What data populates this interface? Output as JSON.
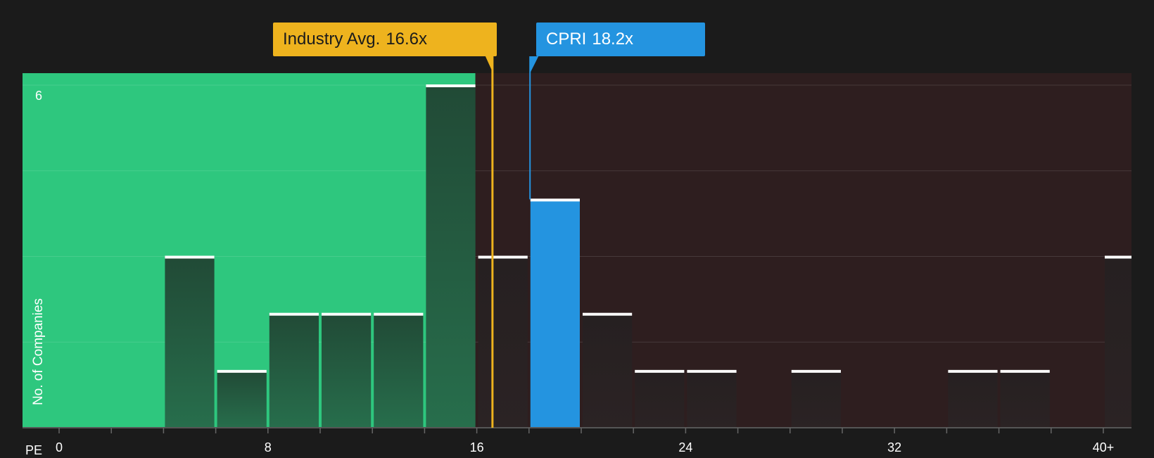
{
  "chart_data": {
    "type": "bar",
    "xlabel": "PE",
    "ylabel": "No. of Companies",
    "ylim": [
      0,
      6
    ],
    "y_tick_shown": "6",
    "x_ticks": [
      "0",
      "8",
      "16",
      "24",
      "32",
      "40+"
    ],
    "bin_width": 2,
    "bins": [
      {
        "x": 4,
        "value": 3
      },
      {
        "x": 6,
        "value": 1
      },
      {
        "x": 8,
        "value": 2
      },
      {
        "x": 10,
        "value": 2
      },
      {
        "x": 12,
        "value": 2
      },
      {
        "x": 14,
        "value": 6
      },
      {
        "x": 16,
        "value": 3
      },
      {
        "x": 18,
        "value": 4
      },
      {
        "x": 20,
        "value": 2
      },
      {
        "x": 22,
        "value": 1
      },
      {
        "x": 24,
        "value": 1
      },
      {
        "x": 28,
        "value": 1
      },
      {
        "x": 34,
        "value": 1
      },
      {
        "x": 36,
        "value": 1
      },
      {
        "x": 40,
        "value": 3
      }
    ],
    "industry_avg": {
      "label": "Industry Avg.",
      "value_label": "16.6x",
      "value": 16.6
    },
    "company": {
      "label": "CPRI",
      "value_label": "18.2x",
      "value": 18.2
    },
    "colors": {
      "background": "#1b1b1b",
      "undervalued_zone": "#2ec77e",
      "overvalued_zone": "#2e1e1f",
      "bar": "#1f4a36",
      "bar_dark": "#2a2222",
      "company_bar": "#2494e0",
      "industry_line": "#eeb31e",
      "company_line": "#2494e0",
      "bar_cap": "#ffffff"
    }
  }
}
